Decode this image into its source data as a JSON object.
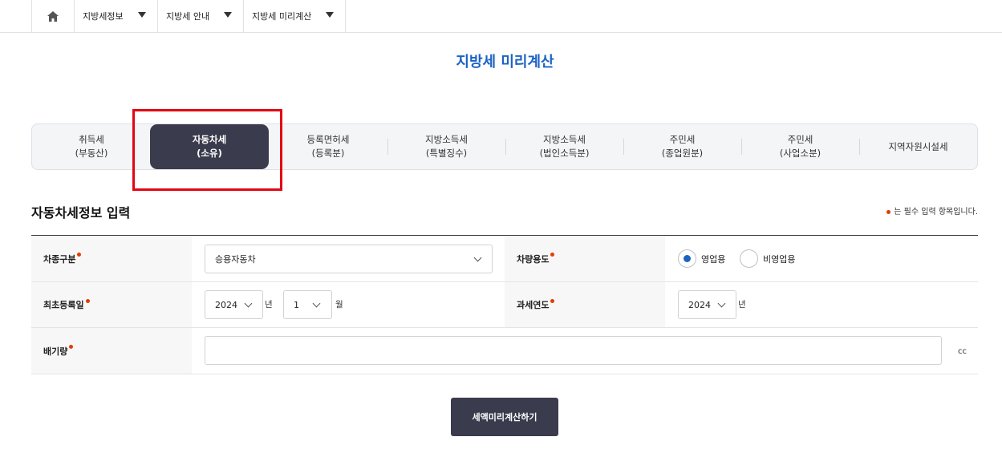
{
  "nav": {
    "home_icon": "home-icon",
    "crumbs": [
      "지방세정보",
      "지방세 안내",
      "지방세 미리계산"
    ]
  },
  "page_title": "지방세 미리계산",
  "tabs": [
    {
      "line1": "취득세",
      "line2": "(부동산)"
    },
    {
      "line1": "자동차세",
      "line2": "(소유)",
      "active": true
    },
    {
      "line1": "등록면허세",
      "line2": "(등록분)"
    },
    {
      "line1": "지방소득세",
      "line2": "(특별징수)"
    },
    {
      "line1": "지방소득세",
      "line2": "(법인소득분)"
    },
    {
      "line1": "주민세",
      "line2": "(종업원분)"
    },
    {
      "line1": "주민세",
      "line2": "(사업소분)"
    },
    {
      "line1": "지역자원시설세",
      "line2": ""
    }
  ],
  "section_title": "자동차세정보 입력",
  "required_note": "는 필수 입력 항목입니다.",
  "form": {
    "vehicle_type_label": "차종구분",
    "vehicle_type_value": "승용자동차",
    "vehicle_use_label": "차량용도",
    "vehicle_use_options": [
      "영업용",
      "비영업용"
    ],
    "vehicle_use_selected": "영업용",
    "first_reg_label": "최초등록일",
    "first_reg_year": "2024",
    "year_unit": "년",
    "first_reg_month": "1",
    "month_unit": "월",
    "tax_year_label": "과세연도",
    "tax_year_value": "2024",
    "displacement_label": "배기량",
    "displacement_value": "",
    "displacement_unit": "cc"
  },
  "calc_button": "세액미리계산하기",
  "colors": {
    "accent": "#1b62c4",
    "dark": "#3a3c4d",
    "required": "#e23d00",
    "highlight": "#e30613"
  }
}
